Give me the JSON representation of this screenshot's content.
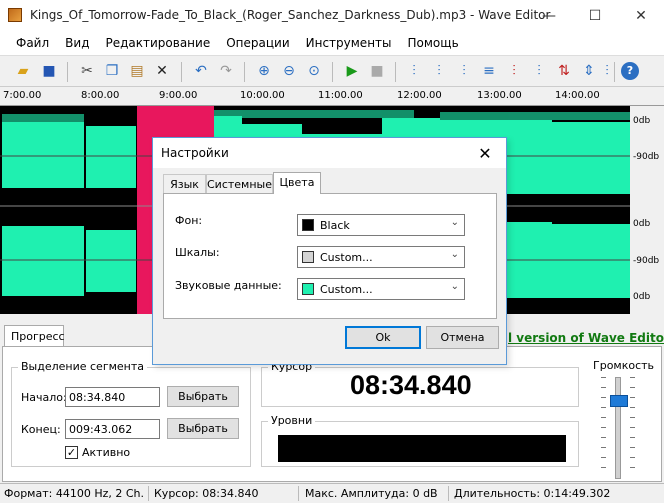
{
  "window": {
    "title": "Kings_Of_Tomorrow-Fade_To_Black_(Roger_Sanchez_Darkness_Dub).mp3 - Wave Editor",
    "minimize": "—",
    "maximize": "☐",
    "close": "✕"
  },
  "menu": [
    "Файл",
    "Вид",
    "Редактирование",
    "Операции",
    "Инструменты",
    "Помощь"
  ],
  "toolbar": {
    "icons": [
      "open-icon",
      "save-icon",
      "cut-icon",
      "copy-icon",
      "paste-icon",
      "delete-icon",
      "undo-icon",
      "redo-icon",
      "zoom-in-icon",
      "zoom-out-icon",
      "zoom-fit-icon",
      "play-icon",
      "stop-icon",
      "fade-in-icon",
      "fade-out-icon",
      "normalize-icon",
      "silence-icon",
      "mute-icon",
      "echo-icon",
      "reverse-icon",
      "invert-icon",
      "amplify-icon",
      "vst-icon",
      "help-icon"
    ]
  },
  "ruler": {
    "ticks": [
      "7:00.00",
      "8:00.00",
      "9:00.00",
      "10:00.00",
      "11:00.00",
      "12:00.00",
      "13:00.00",
      "14:00.00"
    ]
  },
  "db_scale": [
    "0db",
    "-90db",
    "0db",
    "-90db",
    "0db"
  ],
  "colors": {
    "wave": "#1ff0b0",
    "selection": "#e8175d",
    "background": "#000000"
  },
  "bottom": {
    "tab_progress": "Прогресс",
    "promo": "l version of Wave Editor!",
    "selection_group": "Выделение сегмента",
    "start_label": "Начало:",
    "start_value": "08:34.840",
    "end_label": "Конец:",
    "end_value": "009:43.062",
    "select_btn": "Выбрать",
    "active_label": "Активно",
    "cursor_group": "Курсор",
    "cursor_value": "08:34.840",
    "levels_group": "Уровни",
    "volume_label": "Громкость"
  },
  "status": {
    "format": "Формат: 44100 Hz, 2 Ch.",
    "cursor": "Курсор: 08:34.840",
    "max_amp": "Макс. Амплитуда: 0 dB",
    "duration": "Длительность: 0:14:49.302"
  },
  "dialog": {
    "title": "Настройки",
    "tabs": [
      "Язык",
      "Системные",
      "Цвета"
    ],
    "active_tab": "Цвета",
    "rows": [
      {
        "label": "Фон:",
        "value": "Black",
        "swatch": "#000000"
      },
      {
        "label": "Шкалы:",
        "value": "Custom...",
        "swatch": "#d4d4d4"
      },
      {
        "label": "Звуковые данные:",
        "value": "Custom...",
        "swatch": "#1ff0b0"
      }
    ],
    "ok": "Ok",
    "cancel": "Отмена"
  }
}
